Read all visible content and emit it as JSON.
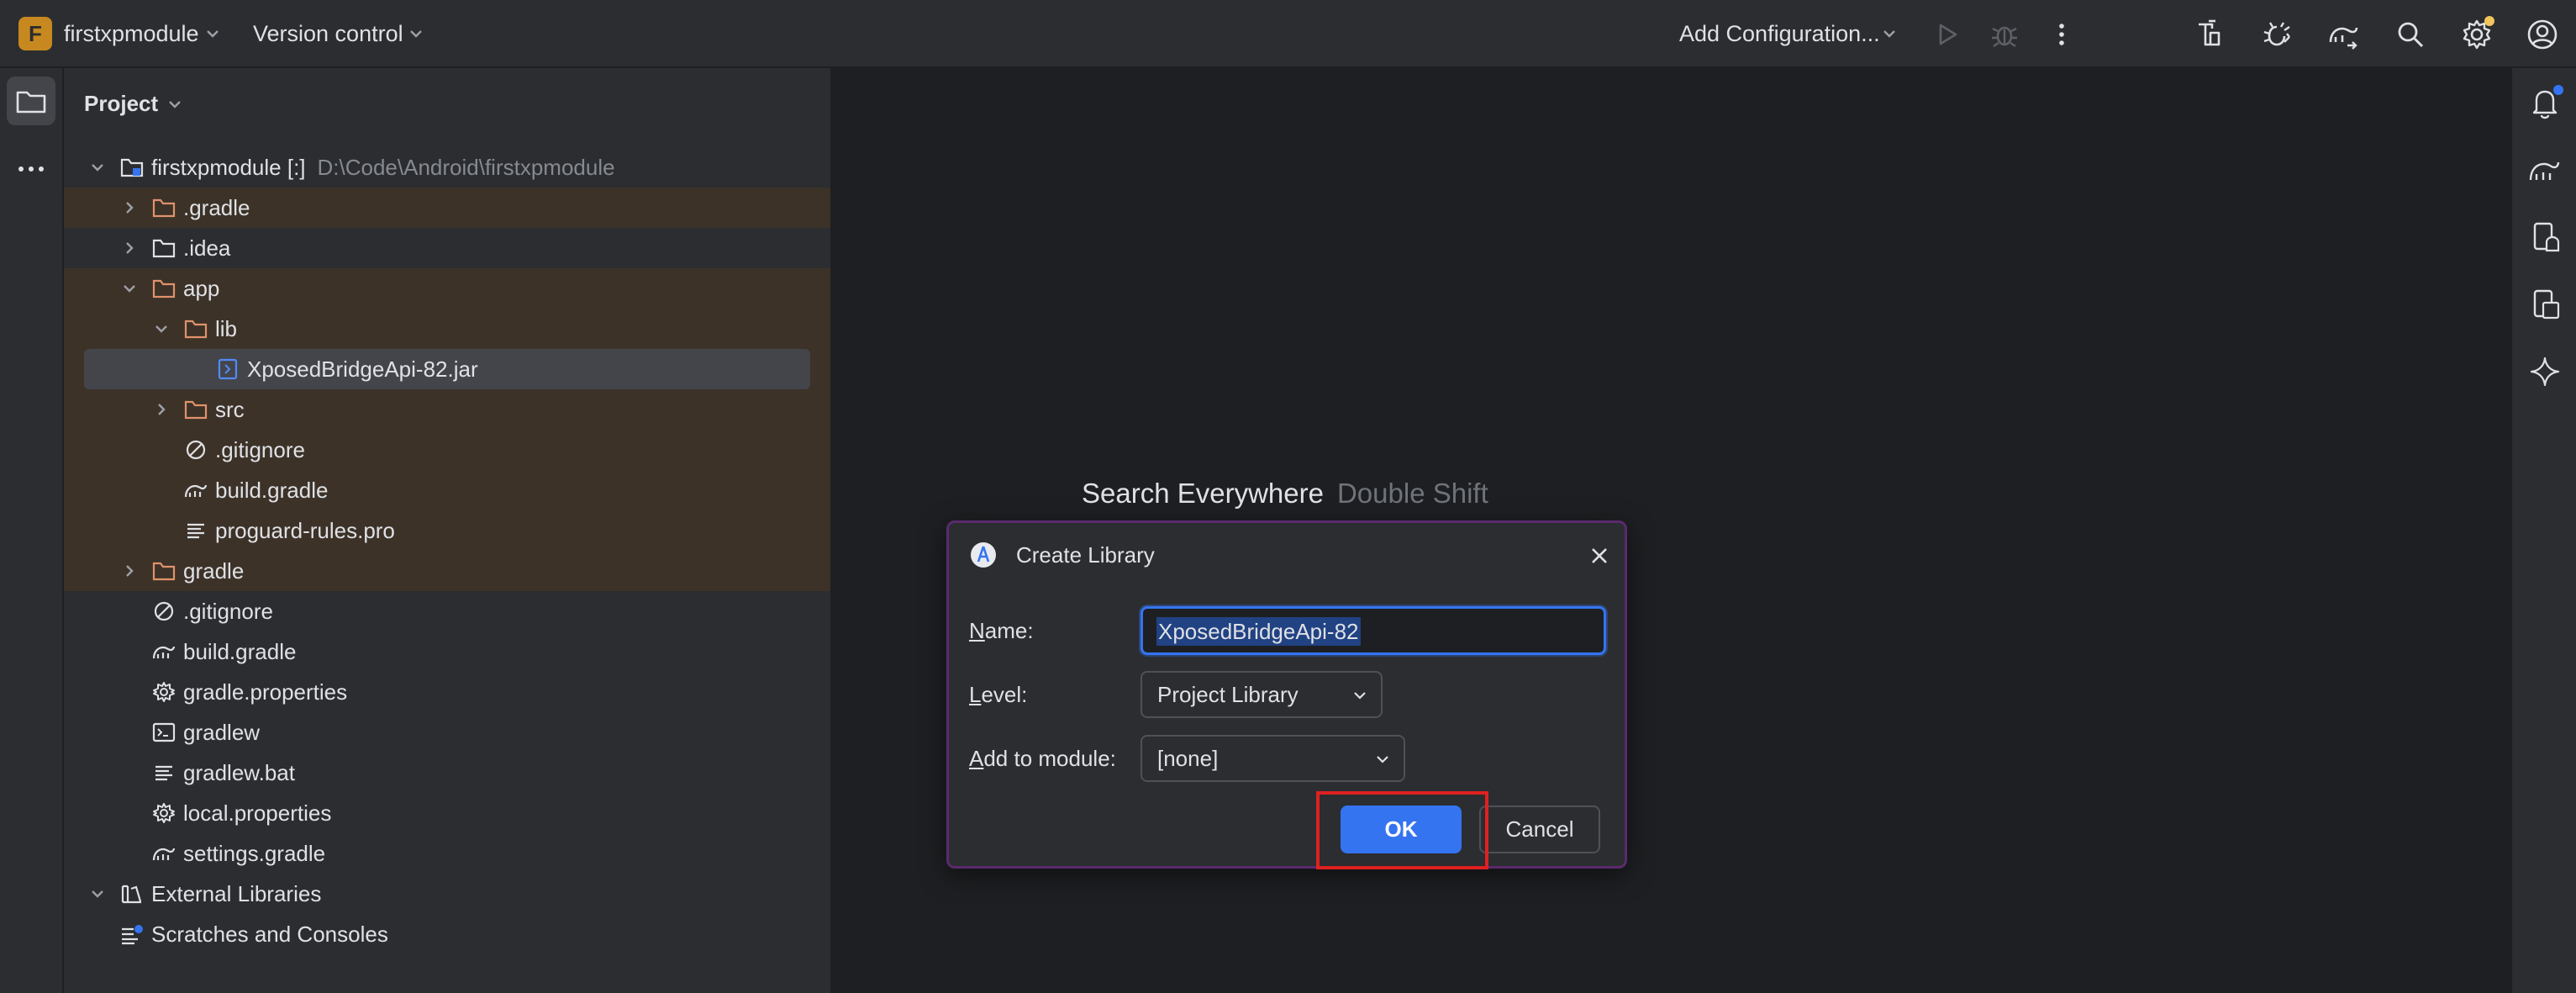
{
  "titlebar": {
    "project_badge": "F",
    "project_name": "firstxpmodule",
    "version_control": "Version control",
    "run_config": "Add Configuration...",
    "icons": [
      "run-icon",
      "debug-icon",
      "more-vert-icon",
      "build-icon",
      "bug-icon",
      "gradle-sync-icon",
      "search-icon",
      "settings-icon",
      "profile-icon"
    ]
  },
  "left_strip": {
    "icons": [
      "project-folder-icon",
      "more-horiz-icon"
    ]
  },
  "project_panel": {
    "title": "Project",
    "tree": [
      {
        "label": "firstxpmodule [:]",
        "path": "D:\\Code\\Android\\firstxpmodule",
        "type": "module"
      },
      {
        "label": ".gradle",
        "type": "folder"
      },
      {
        "label": ".idea",
        "type": "folder"
      },
      {
        "label": "app",
        "type": "folder"
      },
      {
        "label": "lib",
        "type": "folder"
      },
      {
        "label": "XposedBridgeApi-82.jar",
        "type": "jar"
      },
      {
        "label": "src",
        "type": "folder"
      },
      {
        "label": ".gitignore",
        "type": "ignore"
      },
      {
        "label": "build.gradle",
        "type": "gradle"
      },
      {
        "label": "proguard-rules.pro",
        "type": "text"
      },
      {
        "label": "gradle",
        "type": "folder"
      },
      {
        "label": ".gitignore",
        "type": "ignore"
      },
      {
        "label": "build.gradle",
        "type": "gradle"
      },
      {
        "label": "gradle.properties",
        "type": "properties"
      },
      {
        "label": "gradlew",
        "type": "shell"
      },
      {
        "label": "gradlew.bat",
        "type": "text"
      },
      {
        "label": "local.properties",
        "type": "properties"
      },
      {
        "label": "settings.gradle",
        "type": "gradle"
      },
      {
        "label": "External Libraries",
        "type": "libraries"
      },
      {
        "label": "Scratches and Consoles",
        "type": "scratches"
      }
    ]
  },
  "editor": {
    "hint_action": "Search Everywhere",
    "hint_shortcut": "Double Shift"
  },
  "right_strip": {
    "icons": [
      "notifications-icon",
      "gradle-icon",
      "device-manager-icon",
      "running-devices-icon",
      "gemini-icon"
    ]
  },
  "dialog": {
    "title": "Create Library",
    "name_label_mnemonic": "N",
    "name_label_rest": "ame:",
    "name_value": "XposedBridgeApi-82",
    "level_label_mnemonic": "L",
    "level_label_rest": "evel:",
    "level_value": "Project Library",
    "module_label_mnemonic": "A",
    "module_label_rest": "dd to module:",
    "module_value": "[none]",
    "ok_label": "OK",
    "cancel_label": "Cancel"
  },
  "colors": {
    "accent": "#3574f0",
    "highlight_outline": "#e02020",
    "badge": "#c7891f",
    "folder": "#e0926b"
  }
}
